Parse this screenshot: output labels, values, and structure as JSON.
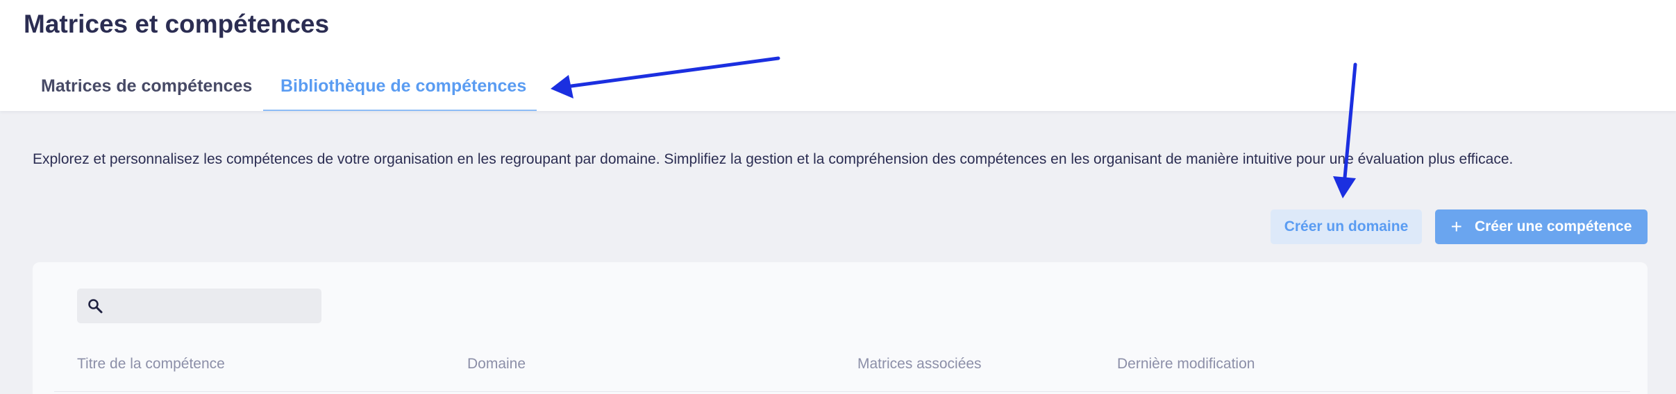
{
  "page": {
    "title": "Matrices et compétences"
  },
  "tabs": [
    {
      "label": "Matrices de compétences",
      "active": false
    },
    {
      "label": "Bibliothèque de compétences",
      "active": true
    }
  ],
  "description": "Explorez et personnalisez les compétences de votre organisation en les regroupant par domaine. Simplifiez la gestion et la compréhension des compétences en les organisant de manière intuitive pour une évaluation plus efficace.",
  "actions": {
    "create_domain_label": "Créer un domaine",
    "create_skill_label": "Créer une compétence",
    "create_skill_icon": "plus-icon"
  },
  "search": {
    "icon": "search-icon",
    "value": "",
    "placeholder": ""
  },
  "table": {
    "columns": [
      "Titre de la compétence",
      "Domaine",
      "Matrices associées",
      "Dernière modification"
    ]
  },
  "annotations": {
    "arrow_color": "#1b2fe0",
    "targets": [
      "tab-library",
      "create-domain-button"
    ]
  },
  "colors": {
    "accent": "#5a9cf2",
    "primary_button": "#6aa5ef",
    "secondary_button": "#dde9f9",
    "page_background": "#eff0f4",
    "heading": "#2b2d52"
  }
}
